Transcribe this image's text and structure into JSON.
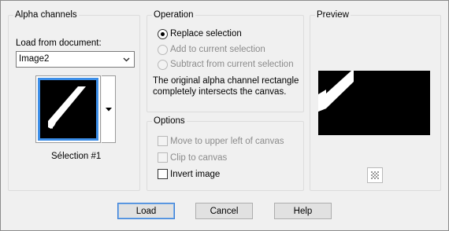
{
  "alpha_channels": {
    "title": "Alpha channels",
    "load_from_label": "Load from document:",
    "document_value": "Image2",
    "channel_name": "Sélection #1"
  },
  "operation": {
    "title": "Operation",
    "options": [
      {
        "label": "Replace selection",
        "selected": true,
        "enabled": true
      },
      {
        "label": "Add to current selection",
        "selected": false,
        "enabled": false
      },
      {
        "label": "Subtract from current selection",
        "selected": false,
        "enabled": false
      }
    ],
    "message_line1": "The original alpha channel rectangle",
    "message_line2": "completely intersects the canvas."
  },
  "options": {
    "title": "Options",
    "checkboxes": [
      {
        "label": "Move to upper left of canvas",
        "checked": false,
        "enabled": false
      },
      {
        "label": "Clip to canvas",
        "checked": false,
        "enabled": false
      },
      {
        "label": "Invert image",
        "checked": false,
        "enabled": true
      }
    ]
  },
  "preview": {
    "title": "Preview",
    "toggle_icon": "checkerboard-icon"
  },
  "buttons": {
    "load": "Load",
    "cancel": "Cancel",
    "help": "Help"
  },
  "colors": {
    "selection_border": "#3c8ee8",
    "default_button_border": "#3c7fd6",
    "disabled_text": "#8b8b8b"
  }
}
